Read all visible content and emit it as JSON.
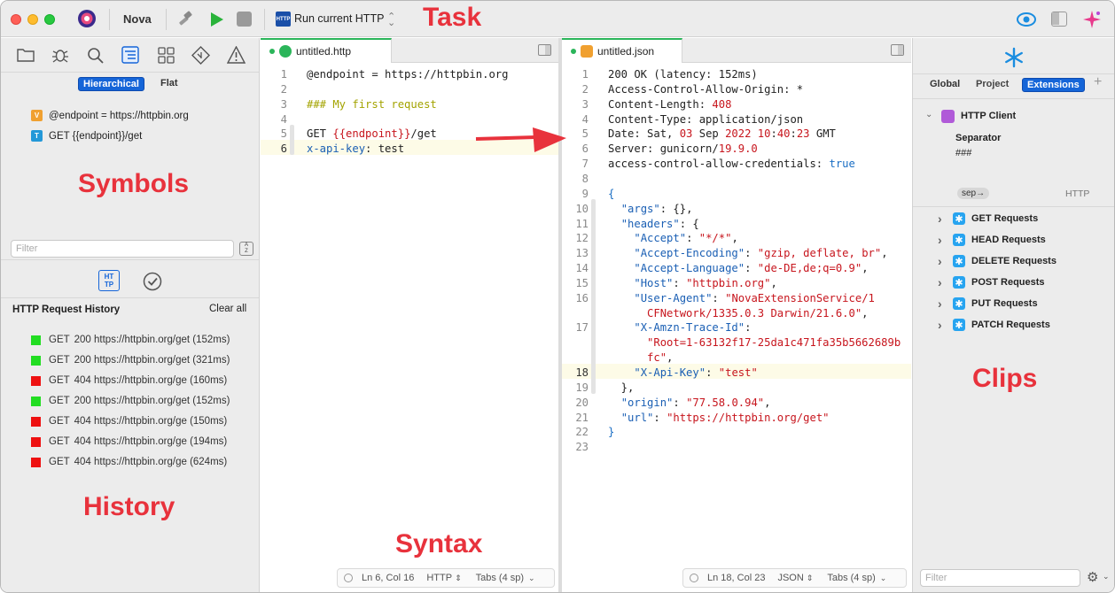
{
  "titlebar": {
    "app_name": "Nova",
    "task_name": "Run current HTTP",
    "task_icon": "HTTP",
    "task_annotation": "Task"
  },
  "left_sidebar": {
    "symbol_toggle": {
      "hierarchical": "Hierarchical",
      "flat": "Flat"
    },
    "symbols": [
      {
        "badge": "V",
        "badge_color": "#f0a030",
        "text": "@endpoint = https://httpbin.org"
      },
      {
        "badge": "T",
        "badge_color": "#2398d8",
        "text": "GET {{endpoint}}/get"
      }
    ],
    "symbols_annotation": "Symbols",
    "filter_placeholder": "Filter",
    "filter_button": "A/Z",
    "history_tab_icon": "HT\nTP",
    "history_title": "HTTP Request History",
    "clear_all": "Clear all",
    "history": [
      {
        "method": "GET",
        "text": "200 https://httpbin.org/get (152ms)",
        "status_color": "#22dd22"
      },
      {
        "method": "GET",
        "text": "200 https://httpbin.org/get (321ms)",
        "status_color": "#22dd22"
      },
      {
        "method": "GET",
        "text": "404 https://httpbin.org/ge (160ms)",
        "status_color": "#ee1111"
      },
      {
        "method": "GET",
        "text": "200 https://httpbin.org/get (152ms)",
        "status_color": "#22dd22"
      },
      {
        "method": "GET",
        "text": "404 https://httpbin.org/ge (150ms)",
        "status_color": "#ee1111"
      },
      {
        "method": "GET",
        "text": "404 https://httpbin.org/ge (194ms)",
        "status_color": "#ee1111"
      },
      {
        "method": "GET",
        "text": "404 https://httpbin.org/ge (624ms)",
        "status_color": "#ee1111"
      }
    ],
    "history_annotation": "History"
  },
  "editor_left": {
    "tab_title": "untitled.http",
    "lines": [
      {
        "n": "1",
        "parts": [
          [
            "@endpoint = https://httpbin.org",
            "kw"
          ]
        ]
      },
      {
        "n": "2",
        "parts": []
      },
      {
        "n": "3",
        "parts": [
          [
            "### My first request",
            "com"
          ]
        ]
      },
      {
        "n": "4",
        "parts": []
      },
      {
        "n": "5",
        "parts": [
          [
            "GET ",
            "kw"
          ],
          [
            "{{endpoint}}",
            "red"
          ],
          [
            "/get",
            "kw"
          ]
        ]
      },
      {
        "n": "6",
        "parts": [
          [
            "x-api-key",
            "blue"
          ],
          [
            ": test",
            "kw"
          ]
        ]
      }
    ],
    "status": {
      "position": "Ln 6, Col 16",
      "syntax": "HTTP",
      "indent": "Tabs (4 sp)"
    },
    "syntax_annotation": "Syntax"
  },
  "editor_right": {
    "tab_title": "untitled.json",
    "lines": [
      {
        "n": "1",
        "parts": [
          [
            "200 OK (latency: 152ms)",
            "kw"
          ]
        ]
      },
      {
        "n": "2",
        "parts": [
          [
            "Access-Control-Allow-Origin: *",
            "kw"
          ]
        ]
      },
      {
        "n": "3",
        "parts": [
          [
            "Content-Length: ",
            "kw"
          ],
          [
            "408",
            "num"
          ]
        ]
      },
      {
        "n": "4",
        "parts": [
          [
            "Content-Type: application/json",
            "kw"
          ]
        ]
      },
      {
        "n": "5",
        "parts": [
          [
            "Date: Sat, ",
            "kw"
          ],
          [
            "03",
            "num"
          ],
          [
            " Sep ",
            "kw"
          ],
          [
            "2022 10",
            "num"
          ],
          [
            ":",
            "kw"
          ],
          [
            "40",
            "num"
          ],
          [
            ":",
            "kw"
          ],
          [
            "23",
            "num"
          ],
          [
            " GMT",
            "kw"
          ]
        ]
      },
      {
        "n": "6",
        "parts": [
          [
            "Server: gunicorn/",
            "kw"
          ],
          [
            "19.9.0",
            "num"
          ]
        ]
      },
      {
        "n": "7",
        "parts": [
          [
            "access-control-allow-credentials: ",
            "kw"
          ],
          [
            "true",
            "bool"
          ]
        ]
      },
      {
        "n": "8",
        "parts": []
      },
      {
        "n": "9",
        "parts": [
          [
            "{",
            "bool"
          ]
        ]
      },
      {
        "n": "10",
        "parts": [
          [
            "  ",
            "kw"
          ],
          [
            "\"args\"",
            "key"
          ],
          [
            ": {},",
            "kw"
          ]
        ]
      },
      {
        "n": "11",
        "parts": [
          [
            "  ",
            "kw"
          ],
          [
            "\"headers\"",
            "key"
          ],
          [
            ": {",
            "kw"
          ]
        ]
      },
      {
        "n": "12",
        "parts": [
          [
            "    ",
            "kw"
          ],
          [
            "\"Accept\"",
            "key"
          ],
          [
            ": ",
            "kw"
          ],
          [
            "\"*/*\"",
            "str"
          ],
          [
            ",",
            "kw"
          ]
        ]
      },
      {
        "n": "13",
        "parts": [
          [
            "    ",
            "kw"
          ],
          [
            "\"Accept-Encoding\"",
            "key"
          ],
          [
            ": ",
            "kw"
          ],
          [
            "\"gzip, deflate, br\"",
            "str"
          ],
          [
            ",",
            "kw"
          ]
        ]
      },
      {
        "n": "14",
        "parts": [
          [
            "    ",
            "kw"
          ],
          [
            "\"Accept-Language\"",
            "key"
          ],
          [
            ": ",
            "kw"
          ],
          [
            "\"de-DE,de;q=0.9\"",
            "str"
          ],
          [
            ",",
            "kw"
          ]
        ]
      },
      {
        "n": "15",
        "parts": [
          [
            "    ",
            "kw"
          ],
          [
            "\"Host\"",
            "key"
          ],
          [
            ": ",
            "kw"
          ],
          [
            "\"httpbin.org\"",
            "str"
          ],
          [
            ",",
            "kw"
          ]
        ]
      },
      {
        "n": "16",
        "parts": [
          [
            "    ",
            "kw"
          ],
          [
            "\"User-Agent\"",
            "key"
          ],
          [
            ": ",
            "kw"
          ],
          [
            "\"NovaExtensionService/1",
            "str"
          ]
        ]
      },
      {
        "n": "",
        "parts": [
          [
            "      ",
            "kw"
          ],
          [
            "CFNetwork/1335.0.3 Darwin/21.6.0\"",
            "str"
          ],
          [
            ",",
            "kw"
          ]
        ]
      },
      {
        "n": "17",
        "parts": [
          [
            "    ",
            "kw"
          ],
          [
            "\"X-Amzn-Trace-Id\"",
            "key"
          ],
          [
            ":",
            "kw"
          ]
        ]
      },
      {
        "n": "",
        "parts": [
          [
            "      ",
            "kw"
          ],
          [
            "\"Root=1-63132f17-25da1c471fa35b5662689b",
            "str"
          ]
        ]
      },
      {
        "n": "",
        "parts": [
          [
            "      ",
            "kw"
          ],
          [
            "fc\"",
            "str"
          ],
          [
            ",",
            "kw"
          ]
        ]
      },
      {
        "n": "18",
        "parts": [
          [
            "    ",
            "kw"
          ],
          [
            "\"X-Api-Key\"",
            "key"
          ],
          [
            ": ",
            "kw"
          ],
          [
            "\"test\"",
            "str"
          ]
        ]
      },
      {
        "n": "19",
        "parts": [
          [
            "  },",
            "kw"
          ]
        ]
      },
      {
        "n": "20",
        "parts": [
          [
            "  ",
            "kw"
          ],
          [
            "\"origin\"",
            "key"
          ],
          [
            ": ",
            "kw"
          ],
          [
            "\"77.58.0.94\"",
            "str"
          ],
          [
            ",",
            "kw"
          ]
        ]
      },
      {
        "n": "21",
        "parts": [
          [
            "  ",
            "kw"
          ],
          [
            "\"url\"",
            "key"
          ],
          [
            ": ",
            "kw"
          ],
          [
            "\"https://httpbin.org/get\"",
            "str"
          ]
        ]
      },
      {
        "n": "22",
        "parts": [
          [
            "}",
            "bool"
          ]
        ]
      },
      {
        "n": "23",
        "parts": []
      }
    ],
    "status": {
      "position": "Ln 18, Col 23",
      "syntax": "JSON",
      "indent": "Tabs (4 sp)"
    }
  },
  "right_sidebar": {
    "tabs": [
      "Global",
      "Project",
      "Extensions"
    ],
    "active_tab": "Extensions",
    "extension_name": "HTTP Client",
    "separator_label": "Separator",
    "separator_value": "###",
    "clip_prefix": "sep→",
    "clip_syntax": "HTTP",
    "clips": [
      "GET Requests",
      "HEAD Requests",
      "DELETE Requests",
      "POST Requests",
      "PUT Requests",
      "PATCH Requests"
    ],
    "clips_annotation": "Clips",
    "filter_placeholder": "Filter"
  },
  "colors": {
    "accent": "#1565d8",
    "annotation": "#e8323c"
  }
}
